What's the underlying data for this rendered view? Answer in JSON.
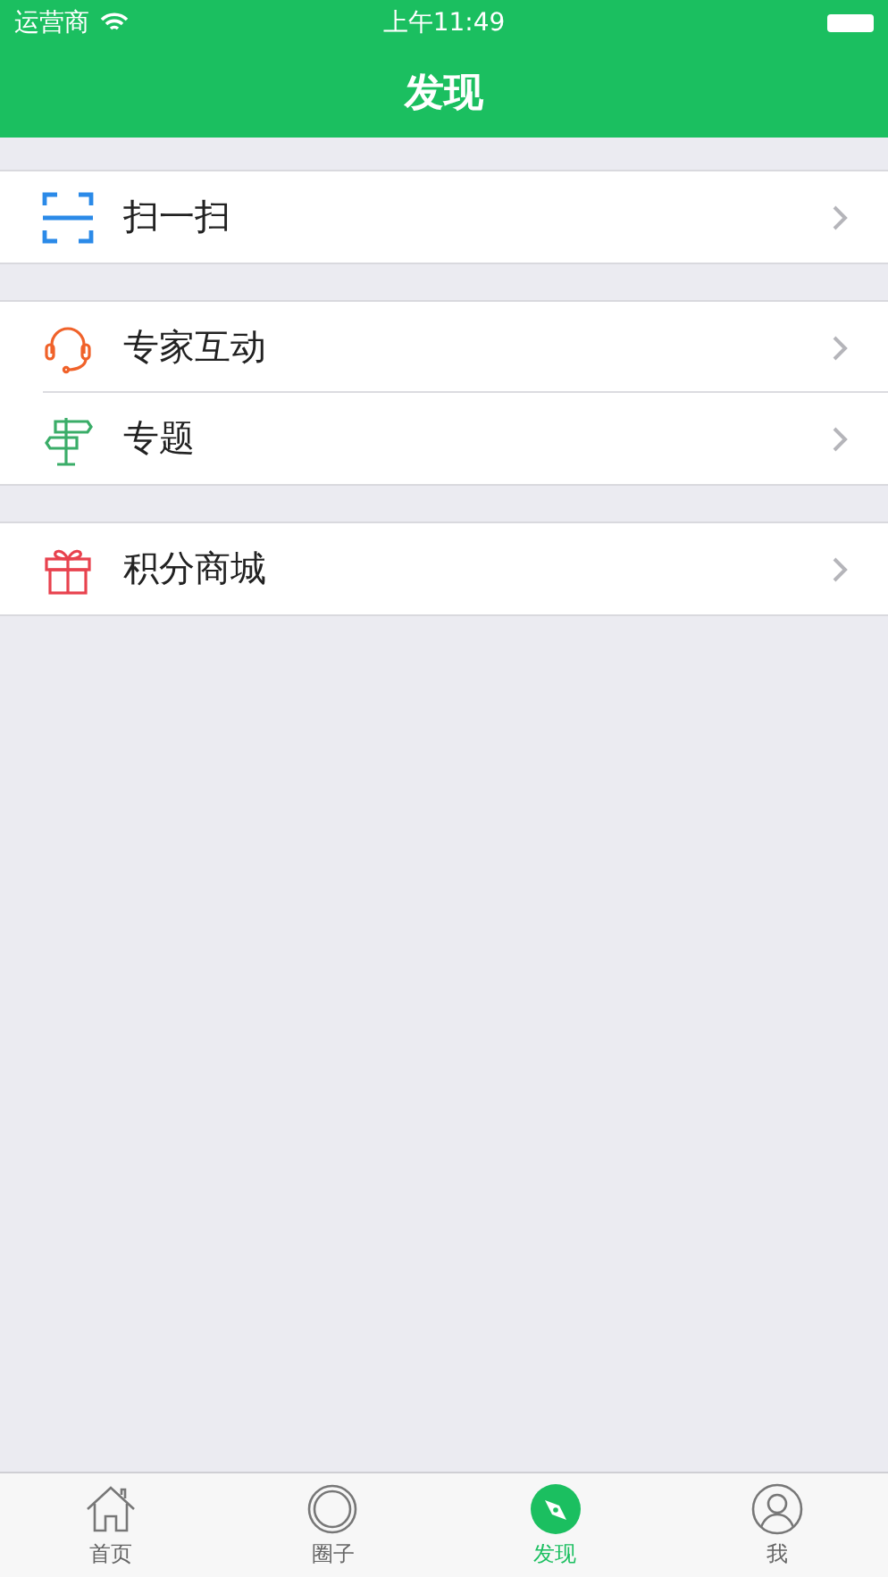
{
  "status_bar": {
    "carrier": "运营商",
    "time": "上午11:49"
  },
  "nav": {
    "title": "发现"
  },
  "sections": [
    {
      "items": [
        {
          "kind": "scan",
          "label": "扫一扫"
        }
      ]
    },
    {
      "items": [
        {
          "kind": "headset",
          "label": "专家互动"
        },
        {
          "kind": "signpost",
          "label": "专题"
        }
      ]
    },
    {
      "items": [
        {
          "kind": "gift",
          "label": "积分商城"
        }
      ]
    }
  ],
  "tabs": [
    {
      "kind": "home",
      "label": "首页",
      "selected": false
    },
    {
      "kind": "circle",
      "label": "圈子",
      "selected": false
    },
    {
      "kind": "compass",
      "label": "发现",
      "selected": true
    },
    {
      "kind": "person",
      "label": "我",
      "selected": false
    }
  ]
}
